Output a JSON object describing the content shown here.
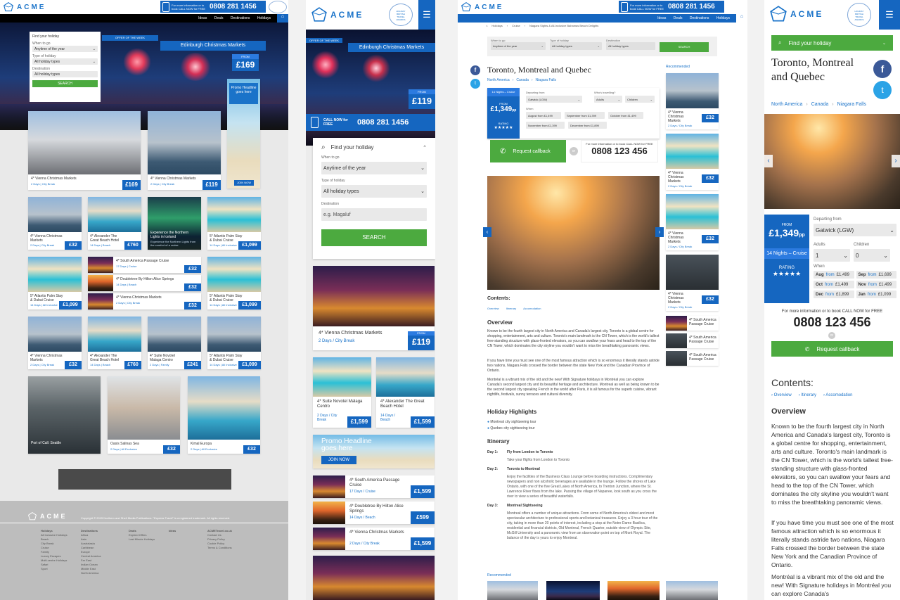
{
  "brand": {
    "name": "ACME",
    "award": [
      "HOLIDAY",
      "BRITISH",
      "TRAVEL",
      "AWARDS"
    ],
    "colors": {
      "primary": "#1566c0",
      "green": "#4caa3f",
      "link": "#1a73c9"
    }
  },
  "phone": {
    "cta": "For more information or to book CALL NOW for FREE",
    "number": "0808 281 1456",
    "number_alt": "0808 123 456",
    "mobile_cta": "CALL NOW for FREE"
  },
  "nav": {
    "items": [
      "Ideas",
      "Deals",
      "Destinations",
      "Holidays"
    ],
    "home_icon": "home-icon"
  },
  "search": {
    "title": "Find your holiday",
    "when_label": "When to go",
    "when_value": "Anytime of the year",
    "type_label": "Type of holiday",
    "type_value": "All holiday types",
    "dest_label": "Destination",
    "dest_value": "All holiday types",
    "dest_placeholder": "e.g. Magaluf",
    "button": "SEARCH"
  },
  "hero": {
    "badge": "OFFER OF THE WEEK",
    "title": "Edinburgh Christmas Markets",
    "price_from": "FROM",
    "price": "£169",
    "price_mobile": "£119"
  },
  "promo": {
    "text": "Promo Headline goes here",
    "join": "JOIN NOW"
  },
  "desktop_cards": {
    "row1": [
      {
        "title": "4* Vienna Christmas Markets",
        "sub": "2 Days | City Break",
        "price": "£169"
      },
      {
        "title": "4* Vienna Christmas Markets",
        "sub": "2 Days | City Break",
        "price": "£119"
      }
    ],
    "row2": [
      {
        "title": "4* Vienna Christmas Markets",
        "sub": "2 Days | City Break",
        "price": "£32"
      },
      {
        "title": "4* Alexander The Great Beach Hotel",
        "sub": "14 Days | Beach",
        "price": "£760"
      },
      {
        "title": "Experience the Northern Lights in Iceland",
        "sub": "Experience the Northern Lights from the comfort of a cruise",
        "price": ""
      },
      {
        "title": "5* Atlantis Palm Stay & Dubai Cruise",
        "sub": "14 Days | All Inclusive",
        "price": "£1,099"
      }
    ],
    "row3": [
      {
        "title": "5* Atlantis Palm Stay & Dubai Cruise",
        "sub": "14 Days | All Inclusive",
        "price": "£1,099"
      },
      {
        "title": "4* South America Passage Cruise",
        "sub": "17 Days | Cruise",
        "price": "£32"
      },
      {
        "title": "4* Doubletree By Hilton Alice Springs",
        "sub": "14 Days | Beach",
        "price": "£32"
      },
      {
        "title": "4* Vienna Christmas Markets",
        "sub": "2 Days | City Break",
        "price": "£32"
      },
      {
        "title": "5* Atlantis Palm Stay & Dubai Cruise",
        "sub": "14 Days | All Inclusive",
        "price": "£1,099"
      }
    ],
    "row4": [
      {
        "title": "4* Vienna Christmas Markets",
        "sub": "2 Days | City Break",
        "price": "£32"
      },
      {
        "title": "4* Alexander The Great Beach Hotel",
        "sub": "14 Days | Beach",
        "price": "£760"
      },
      {
        "title": "4* Suite Novotel Malaga Centro",
        "sub": "2 Days | Family",
        "price": "£241"
      },
      {
        "title": "5* Atlantis Palm Stay & Dubai Cruise",
        "sub": "14 Days | All Inclusive",
        "price": "£1,099"
      }
    ],
    "row5": [
      {
        "title": "Port of Call: Seattle",
        "sub": "",
        "price": ""
      },
      {
        "title": "Oasis Salinas Sea",
        "sub": "2 Days | All Exclusive",
        "price": "£32"
      },
      {
        "title": "Kimal Europa",
        "sub": "2 Days | All Exclusive",
        "price": "£32"
      }
    ]
  },
  "footer": {
    "copyright": "Copyright © 2015 Northern and Shell Media Publications. \"Express Travel\" is a registered trademark. All rights reserved.",
    "cols": [
      {
        "head": "Holidays",
        "items": [
          "All Inclusive Holidays",
          "Beach",
          "City Break",
          "Cruise",
          "Family",
          "Luxury Escapes",
          "Multi-centre Holidays",
          "Safari",
          "Sport"
        ]
      },
      {
        "head": "Destinations",
        "items": [
          "Africa",
          "Asia",
          "Australasia",
          "Caribbean",
          "Europe",
          "Central America",
          "Far East",
          "Indian Ocean",
          "Middle East",
          "North America"
        ]
      },
      {
        "head": "Deals",
        "items": [
          "Expired Offers",
          "Last Minute Holidays"
        ]
      },
      {
        "head": "Ideas",
        "items": []
      },
      {
        "head": "ACMETravel.co.uk",
        "items": [
          "Contact Us",
          "Privacy Policy",
          "Cookie Policy",
          "Terms & Conditions"
        ]
      }
    ]
  },
  "mobile_cards": [
    {
      "title": "4* Vienna Christmas Markets",
      "sub": "2 Days / City Break",
      "price": "£119"
    },
    {
      "title": "4* Suite Novotel Malaga Centro",
      "sub": "2 Days / City Break",
      "price": "£1,599"
    },
    {
      "title": "4* Alexander The Great Beach Hotel",
      "sub": "14 Days / Beach",
      "price": "£1,599"
    },
    {
      "title": "4* South America Passage Cruise",
      "sub": "17 Days / Cruise",
      "price": "£1,599"
    },
    {
      "title": "4* Doubletree By Hilton Alice Springs",
      "sub": "14 Days / Beach",
      "price": "£599"
    },
    {
      "title": "4* Vienna Christmas Markets",
      "sub": "2 Days / City Break",
      "price": "£1,599"
    }
  ],
  "detail": {
    "breadcrumb": [
      "Holidays",
      "Cruise",
      "Niagara Sights & All-Inclusive Bahamas Beach Delights"
    ],
    "title": "Toronto, Montreal and Quebec",
    "locations": [
      "North America",
      "Canada",
      "Niagara Falls"
    ],
    "duration": "14 Nights – Cruise",
    "from": "FROM",
    "price": "£1,349",
    "pp": "pp",
    "rating": "RATING",
    "stars": "★★★★★",
    "departing_label": "Departing from",
    "departing_value": "Gatwick (LGW)",
    "travelling_label": "Who's travelling?",
    "adults": "Adults",
    "children": "Children",
    "adults_val": "1",
    "children_val": "0",
    "when_label": "When",
    "dates": [
      [
        "Aug",
        "£1,499"
      ],
      [
        "Sep",
        "£1,699"
      ],
      [
        "Oct",
        "£1,499"
      ],
      [
        "Nov",
        "£1,499"
      ],
      [
        "Dec",
        "£1,899"
      ],
      [
        "Jan",
        "£1,099"
      ]
    ],
    "dates_long": [
      "August from £1,499",
      "September from £1,399",
      "October from £1,499",
      "November from £1,399",
      "December from £1,899"
    ],
    "callback": "Request callback",
    "or": "or",
    "contents": "Contents:",
    "contents_links": [
      "Overview",
      "Itinerary",
      "Accomodation"
    ],
    "overview_h": "Overview",
    "overview_p1": "Known to be the fourth largest city in North America and Canada's largest city, Toronto is a global centre for shopping, entertainment, arts and culture. Toronto's main landmark is the CN Tower, which is the world's tallest free-standing structure with glass-fronted elevators, so you can swallow your fears and head to the top of the CN Tower, which dominates the city skyline you wouldn't want to miss the breathtaking panoramic views.",
    "overview_p2": "If you have time you must see one of the most famous attraction which is so enormous it literally stands astride two nations, Niagara Falls crossed the border between the state New York and the Canadian Province of Ontario.",
    "overview_p3": "Montréal is a vibrant mix of the old and the new! With Signature holidays in Montréal you can explore Canada's second largest city and its beautiful heritage and architecture. Montreal as well as being known to be the second largest city speaking French in the world after Paris, it is all famous for the superb cuisine, vibrant nightlife, festivals, sunny terraces and cultural diversity.",
    "highlights_h": "Holiday Highlights",
    "highlights": [
      "Montreal city sightseeing tour",
      "Quebec city sightseeing tour"
    ],
    "itinerary_h": "Itinerary",
    "itinerary": [
      {
        "day": "Day 1:",
        "title": "Fly from London to Toronto",
        "text": "Take your flights from London to Toronto"
      },
      {
        "day": "Day 2:",
        "title": "Toronto to Montreal",
        "text": "Enjoy the facilities of the Business Class Lounge before boarding instructions. Complimentary newspapers and non alcoholic beverages are available in the lounge. Follow the shores of Lake Ontario, with one of the five Great Lakes of North America, to Trenton Junction, where the St. Lawrence River flows from the lake. Passing the village of Napanee, look south as you cross the river to view a series of beautiful waterfalls."
      },
      {
        "day": "Day 3:",
        "title": "Montreal Sightseeing",
        "text": "Montreal offers a number of unique attractions. From some of North America's oldest and most spectacular architecture to professional sports and botanical treasures. Enjoy a 3 hour tour of the city, taking in more than 20 points of interest, including a stop at the Notre Dame Basilica, residential and financial districts, Old Montreal, French Quarter, outside view of Olympic Site, McGill University and a panoramic view from an observation point on top of Mont Royal. The balance of the day is yours to enjoy Montreal."
      }
    ],
    "recommended": "Recommended",
    "rec_items": [
      {
        "title": "4* Vienna Christmas Markets",
        "sub": "2 Days / City Break",
        "price": "£32"
      },
      {
        "title": "4* Vienna Christmas Markets",
        "sub": "2 Days / City Break",
        "price": "£32"
      },
      {
        "title": "4* Vienna Christmas Markets",
        "sub": "2 Days / City Break",
        "price": "£32"
      },
      {
        "title": "4* Vienna Christmas Markets",
        "sub": "2 Days / City Break",
        "price": "£32"
      }
    ],
    "rec_small": [
      "4* South America Passage Cruise",
      "4* South America Passage Cruise",
      "4* South America Passage Cruise"
    ],
    "mobile_overview_p1": "Known to be the fourth largest city in North America and Canada's largest city, Toronto is a global centre for shopping, entertainment, arts and culture. Toronto's main landmark is the CN Tower, which is the world's tallest free-standing structure with glass-fronted elevators, so you can swallow your fears and head to the top of the CN Tower, which dominates the city skyline you wouldn't want to miss the breathtaking panoramic views.",
    "mobile_overview_p2": "If you have time you must see one of the most famous attraction which is so enormous it literally stands astride two nations, Niagara Falls crossed the border between the state New York and the Canadian Province of Ontario.",
    "mobile_overview_p3": "Montréal is a vibrant mix of the old and the new! With Signature holidays in Montréal you can explore Canada's"
  }
}
